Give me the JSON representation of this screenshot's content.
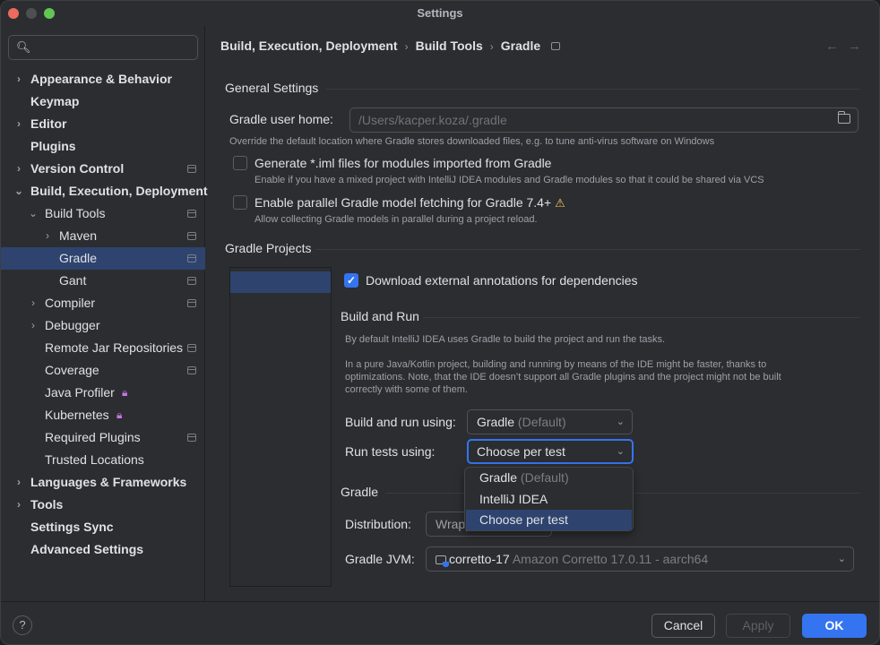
{
  "window": {
    "title": "Settings"
  },
  "search": {
    "placeholder": ""
  },
  "sidebar": {
    "items": [
      {
        "label": "Appearance & Behavior",
        "level": 0,
        "expandable": true,
        "expanded": false,
        "bold": true,
        "project": false
      },
      {
        "label": "Keymap",
        "level": 0,
        "expandable": false,
        "bold": true,
        "project": false
      },
      {
        "label": "Editor",
        "level": 0,
        "expandable": true,
        "expanded": false,
        "bold": true,
        "project": false
      },
      {
        "label": "Plugins",
        "level": 0,
        "expandable": false,
        "bold": true,
        "project": false
      },
      {
        "label": "Version Control",
        "level": 0,
        "expandable": true,
        "expanded": false,
        "bold": true,
        "project": true
      },
      {
        "label": "Build, Execution, Deployment",
        "level": 0,
        "expandable": true,
        "expanded": true,
        "bold": true,
        "project": false
      },
      {
        "label": "Build Tools",
        "level": 1,
        "expandable": true,
        "expanded": true,
        "project": true
      },
      {
        "label": "Maven",
        "level": 2,
        "expandable": true,
        "expanded": false,
        "project": true
      },
      {
        "label": "Gradle",
        "level": 2,
        "expandable": false,
        "project": true,
        "selected": true
      },
      {
        "label": "Gant",
        "level": 2,
        "expandable": false,
        "project": true
      },
      {
        "label": "Compiler",
        "level": 1,
        "expandable": true,
        "expanded": false,
        "project": true
      },
      {
        "label": "Debugger",
        "level": 1,
        "expandable": true,
        "expanded": false,
        "project": false
      },
      {
        "label": "Remote Jar Repositories",
        "level": 1,
        "expandable": false,
        "project": true
      },
      {
        "label": "Coverage",
        "level": 1,
        "expandable": false,
        "project": true
      },
      {
        "label": "Java Profiler",
        "level": 1,
        "expandable": false,
        "project": false,
        "locked": true
      },
      {
        "label": "Kubernetes",
        "level": 1,
        "expandable": false,
        "project": false,
        "locked": true
      },
      {
        "label": "Required Plugins",
        "level": 1,
        "expandable": false,
        "project": true
      },
      {
        "label": "Trusted Locations",
        "level": 1,
        "expandable": false,
        "project": false
      },
      {
        "label": "Languages & Frameworks",
        "level": 0,
        "expandable": true,
        "expanded": false,
        "bold": true,
        "project": false
      },
      {
        "label": "Tools",
        "level": 0,
        "expandable": true,
        "expanded": false,
        "bold": true,
        "project": false
      },
      {
        "label": "Settings Sync",
        "level": 0,
        "expandable": false,
        "bold": true,
        "project": false
      },
      {
        "label": "Advanced Settings",
        "level": 0,
        "expandable": false,
        "bold": true,
        "project": false
      }
    ]
  },
  "breadcrumb": [
    "Build, Execution, Deployment",
    "Build Tools",
    "Gradle"
  ],
  "general": {
    "title": "General Settings",
    "user_home_label": "Gradle user home:",
    "user_home_placeholder": "/Users/kacper.koza/.gradle",
    "user_home_hint": "Override the default location where Gradle stores downloaded files, e.g. to tune anti-virus software on Windows",
    "generate_iml": {
      "label": "Generate *.iml files for modules imported from Gradle",
      "checked": false,
      "hint": "Enable if you have a mixed project with IntelliJ IDEA modules and Gradle modules so that it could be shared via VCS"
    },
    "parallel_fetch": {
      "label": "Enable parallel Gradle model fetching for Gradle 7.4+",
      "checked": false,
      "hint": "Allow collecting Gradle models in parallel during a project reload."
    }
  },
  "projects": {
    "title": "Gradle Projects",
    "download_annotations": {
      "label": "Download external annotations for dependencies",
      "checked": true
    },
    "build_run": {
      "title": "Build and Run",
      "para1": "By default IntelliJ IDEA uses Gradle to build the project and run the tasks.",
      "para2": "In a pure Java/Kotlin project, building and running by means of the IDE might be faster, thanks to optimizations. Note, that the IDE doesn’t support all Gradle plugins and the project might not be built correctly with some of them.",
      "build_using_label": "Build and run using:",
      "build_using_value": "Gradle",
      "build_using_suffix": "(Default)",
      "tests_using_label": "Run tests using:",
      "tests_using_value": "Choose per test",
      "options": [
        {
          "label": "Gradle",
          "suffix": "(Default)"
        },
        {
          "label": "IntelliJ IDEA",
          "suffix": ""
        },
        {
          "label": "Choose per test",
          "suffix": "",
          "selected": true
        }
      ]
    },
    "gradle": {
      "title": "Gradle",
      "distribution_label": "Distribution:",
      "distribution_value": "Wrapper",
      "jvm_label": "Gradle JVM:",
      "jvm_name": "corretto-17",
      "jvm_detail": "Amazon Corretto 17.0.11 - aarch64"
    }
  },
  "footer": {
    "help": "?",
    "cancel": "Cancel",
    "apply": "Apply",
    "ok": "OK"
  },
  "colors": {
    "accent": "#3574f0",
    "selection": "#2e436e",
    "background": "#2b2d30",
    "warning": "#f2c55c",
    "lock": "#c775e8"
  }
}
